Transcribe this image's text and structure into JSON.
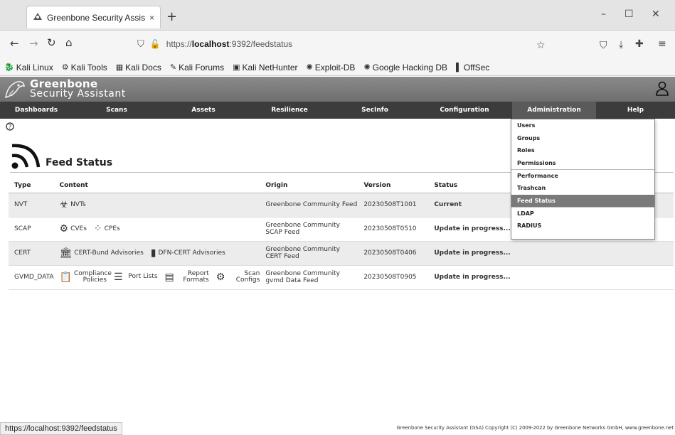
{
  "browser": {
    "tab_title": "Greenbone Security Assis",
    "tab_close": "×",
    "new_tab": "+",
    "url_prefix": "https://",
    "url_host": "localhost",
    "url_rest": ":9392/feedstatus",
    "window_controls": {
      "minimize": "–",
      "maximize": "☐",
      "close": "✕"
    }
  },
  "bookmarks": [
    {
      "label": "Kali Linux",
      "icon": "kali-dragon-icon"
    },
    {
      "label": "Kali Tools",
      "icon": "kali-tools-icon"
    },
    {
      "label": "Kali Docs",
      "icon": "kali-docs-icon"
    },
    {
      "label": "Kali Forums",
      "icon": "kali-forums-icon"
    },
    {
      "label": "Kali NetHunter",
      "icon": "nethunter-icon"
    },
    {
      "label": "Exploit-DB",
      "icon": "exploit-db-icon"
    },
    {
      "label": "Google Hacking DB",
      "icon": "ghdb-icon"
    },
    {
      "label": "OffSec",
      "icon": "offsec-icon"
    }
  ],
  "gsa": {
    "brand_line1": "Greenbone",
    "brand_line2": "Security Assistant",
    "menu": [
      "Dashboards",
      "Scans",
      "Assets",
      "Resilience",
      "SecInfo",
      "Configuration",
      "Administration",
      "Help"
    ],
    "active_menu": "Administration"
  },
  "admin_dropdown": [
    {
      "label": "Users",
      "selected": false,
      "sep": false
    },
    {
      "label": "Groups",
      "selected": false,
      "sep": false
    },
    {
      "label": "Roles",
      "selected": false,
      "sep": false
    },
    {
      "label": "Permissions",
      "selected": false,
      "sep": false
    },
    {
      "label": "Performance",
      "selected": false,
      "sep": true
    },
    {
      "label": "Trashcan",
      "selected": false,
      "sep": false
    },
    {
      "label": "Feed Status",
      "selected": true,
      "sep": false
    },
    {
      "label": "LDAP",
      "selected": false,
      "sep": true
    },
    {
      "label": "RADIUS",
      "selected": false,
      "sep": false
    }
  ],
  "page": {
    "title": "Feed Status",
    "columns": {
      "type": "Type",
      "content": "Content",
      "origin": "Origin",
      "version": "Version",
      "status": "Status"
    },
    "rows": [
      {
        "type": "NVT",
        "content": [
          {
            "icon": "biohazard-icon",
            "glyph": "☣",
            "label": "NVTs"
          }
        ],
        "origin": "Greenbone Community Feed",
        "version": "20230508T1001",
        "status": "Current"
      },
      {
        "type": "SCAP",
        "content": [
          {
            "icon": "cve-icon",
            "glyph": "⚙",
            "label": "CVEs"
          },
          {
            "icon": "cpe-icon",
            "glyph": "⁘",
            "label": "CPEs"
          }
        ],
        "origin": "Greenbone Community SCAP Feed",
        "version": "20230508T0510",
        "status": "Update in progress..."
      },
      {
        "type": "CERT",
        "content": [
          {
            "icon": "cert-bund-icon",
            "glyph": "🏛",
            "label": "CERT-Bund Advisories"
          },
          {
            "icon": "dfn-cert-icon",
            "glyph": "▮",
            "label": "DFN-CERT Advisories"
          }
        ],
        "origin": "Greenbone Community CERT Feed",
        "version": "20230508T0406",
        "status": "Update in progress..."
      },
      {
        "type": "GVMD_DATA",
        "content": [
          {
            "icon": "compliance-policies-icon",
            "glyph": "📋",
            "label": "Compliance Policies"
          },
          {
            "icon": "port-lists-icon",
            "glyph": "☰",
            "label": "Port Lists"
          },
          {
            "icon": "report-formats-icon",
            "glyph": "▤",
            "label": "Report Formats"
          },
          {
            "icon": "scan-configs-icon",
            "glyph": "⚙",
            "label": "Scan Configs"
          }
        ],
        "origin": "Greenbone Community gvmd Data Feed",
        "version": "20230508T0905",
        "status": "Update in progress..."
      }
    ]
  },
  "statusbar_url": "https://localhost:9392/feedstatus",
  "copyright": "Greenbone Security Assistant (GSA) Copyright (C) 2009-2022 by Greenbone Networks GmbH, www.greenbone.net"
}
